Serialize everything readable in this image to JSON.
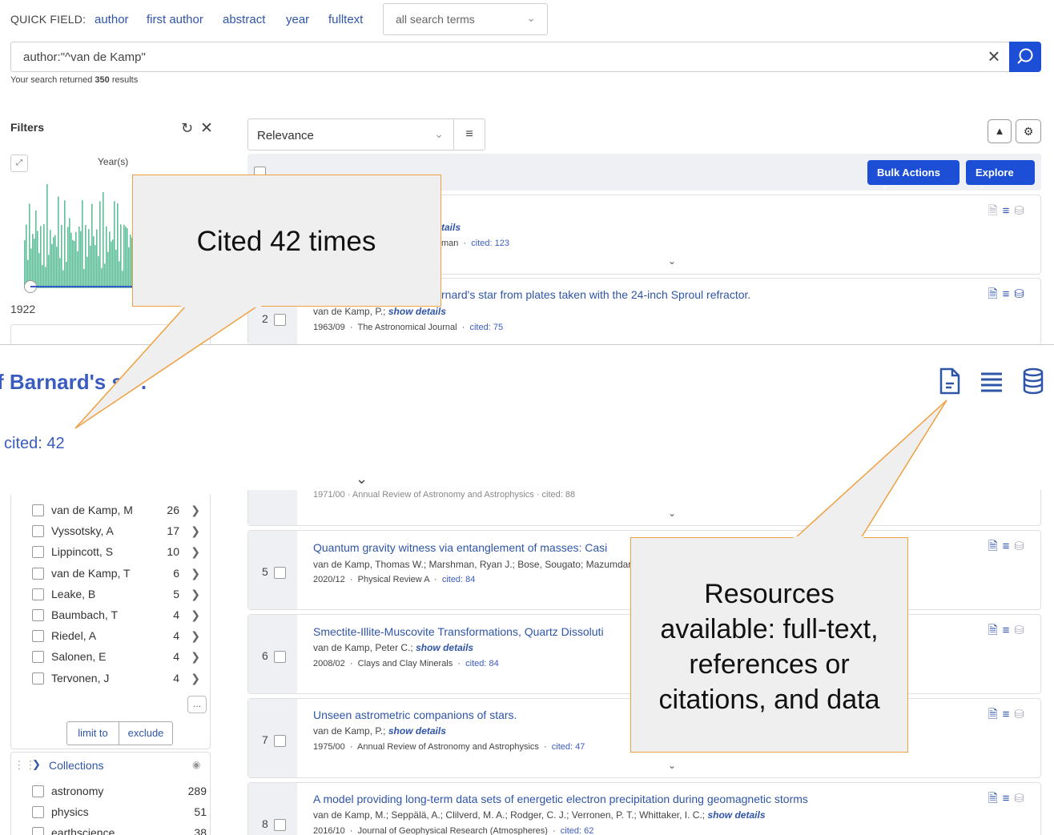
{
  "quick_field": {
    "label": "QUICK FIELD:",
    "links": [
      "author",
      "first author",
      "abstract",
      "year",
      "fulltext"
    ],
    "terms_select": "all search terms"
  },
  "search": {
    "query": "author:\"^van de Kamp\"",
    "result_prefix": "Your search returned",
    "result_count": "350",
    "result_suffix": "results"
  },
  "filters": {
    "title": "Filters",
    "year_title": "Year(s)",
    "year_start": "1922",
    "authors": [
      {
        "label": "van de Kamp, M",
        "count": "26"
      },
      {
        "label": "Vyssotsky, A",
        "count": "17"
      },
      {
        "label": "Lippincott, S",
        "count": "10"
      },
      {
        "label": "van de Kamp, T",
        "count": "6"
      },
      {
        "label": "Leake, B",
        "count": "5"
      },
      {
        "label": "Baumbach, T",
        "count": "4"
      },
      {
        "label": "Riedel, A",
        "count": "4"
      },
      {
        "label": "Salonen, E",
        "count": "4"
      },
      {
        "label": "Tervonen, J",
        "count": "4"
      }
    ],
    "more": "...",
    "limit_to": "limit to",
    "exclude": "exclude",
    "collections_title": "Collections",
    "collections": [
      {
        "label": "astronomy",
        "count": "289"
      },
      {
        "label": "physics",
        "count": "51"
      },
      {
        "label": "earthscience",
        "count": "38"
      }
    ]
  },
  "results_toolbar": {
    "sort": "Relevance",
    "bulk_actions": "Bulk Actions",
    "explore": "Explore"
  },
  "results": [
    {
      "authors_tail": "tails",
      "meta_tail": "man",
      "cited": "cited: 123"
    },
    {
      "num": "2",
      "title_tail": "rnard's star from plates taken with the 24-inch Sproul refractor.",
      "authors": "van de Kamp, P.;",
      "show_details": "show details",
      "date": "1963/09",
      "journal": "The Astronomical Journal",
      "cited": "cited: 75"
    },
    {
      "meta_partial": "1971/00  ·  Annual Review of Astronomy and Astrophysics  ·  cited: 88"
    },
    {
      "num": "5",
      "title": "Quantum gravity witness via entanglement of masses: Casi",
      "authors": "van de Kamp, Thomas W.; Marshman, Ryan J.; Bose, Sougato; Mazumdar",
      "date": "2020/12",
      "journal": "Physical Review A",
      "cited": "cited: 84"
    },
    {
      "num": "6",
      "title": "Smectite-Illite-Muscovite Transformations, Quartz Dissoluti",
      "authors": "van de Kamp, Peter C.;",
      "show_details": "show details",
      "date": "2008/02",
      "journal": "Clays and Clay Minerals",
      "cited": "cited: 84"
    },
    {
      "num": "7",
      "title": "Unseen astrometric companions of stars.",
      "authors": "van de Kamp, P.;",
      "show_details": "show details",
      "date": "1975/00",
      "journal": "Annual Review of Astronomy and Astrophysics",
      "cited": "cited: 47"
    },
    {
      "num": "8",
      "title": "A model providing long-term data sets of energetic electron precipitation during geomagnetic storms",
      "authors": "van de Kamp, M.; Seppälä, A.; Clilverd, M. A.; Rodger, C. J.; Verronen, P. T.; Whittaker, I. C.;",
      "show_details": "show details",
      "date": "2016/10",
      "journal": "Journal of Geophysical Research (Atmospheres)",
      "cited": "cited: 62"
    }
  ],
  "zoom": {
    "title": "f Barnard's s",
    "title_tail": ".",
    "cited": "cited: 42"
  },
  "callouts": {
    "cited": "Cited 42 times",
    "resources": [
      "Resources",
      "available:  full-text,",
      "references or",
      "citations, and data"
    ]
  },
  "colors": {
    "primary": "#1c4fd6",
    "link": "#2f55a8",
    "callout_border": "#f0a040",
    "histogram": "#5fbf99"
  }
}
